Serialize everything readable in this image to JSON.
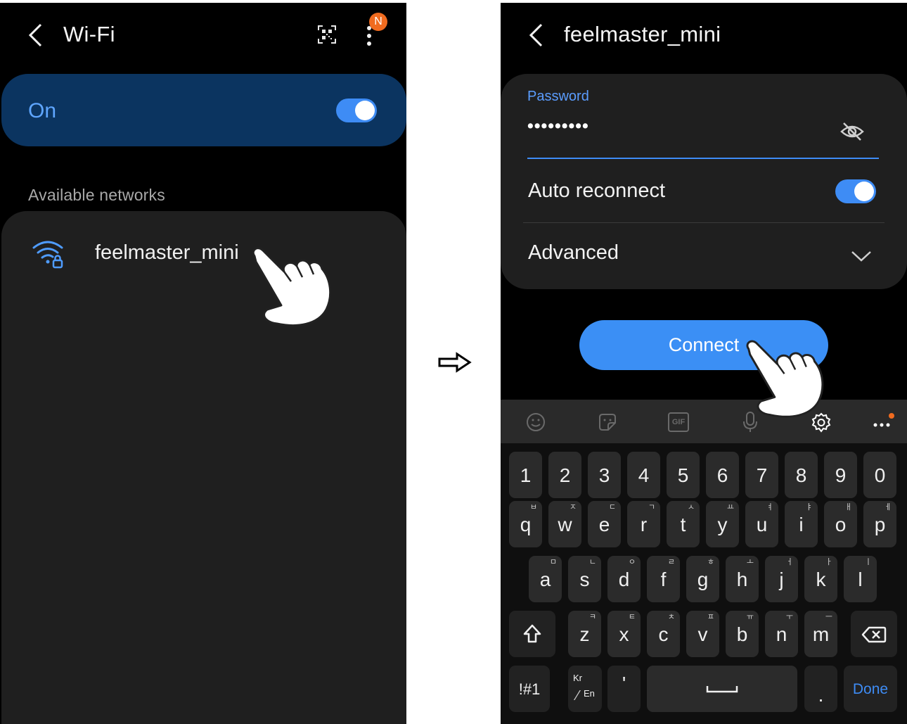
{
  "left_screen": {
    "title": "Wi-Fi",
    "notification_badge": "N",
    "wifi_toggle_label": "On",
    "section_header": "Available networks",
    "networks": [
      {
        "name": "feelmaster_mini",
        "secured": true
      }
    ]
  },
  "transition_arrow": "⇨",
  "right_screen": {
    "title": "feelmaster_mini",
    "password_label": "Password",
    "password_value": "•••••••••",
    "auto_reconnect_label": "Auto reconnect",
    "advanced_label": "Advanced",
    "connect_button": "Connect",
    "keyboard": {
      "number_row": [
        "1",
        "2",
        "3",
        "4",
        "5",
        "6",
        "7",
        "8",
        "9",
        "0"
      ],
      "row1": [
        {
          "key": "q",
          "sub": "ㅂ"
        },
        {
          "key": "w",
          "sub": "ㅈ"
        },
        {
          "key": "e",
          "sub": "ㄷ"
        },
        {
          "key": "r",
          "sub": "ㄱ"
        },
        {
          "key": "t",
          "sub": "ㅅ"
        },
        {
          "key": "y",
          "sub": "ㅛ"
        },
        {
          "key": "u",
          "sub": "ㅕ"
        },
        {
          "key": "i",
          "sub": "ㅑ"
        },
        {
          "key": "o",
          "sub": "ㅐ"
        },
        {
          "key": "p",
          "sub": "ㅔ"
        }
      ],
      "row2": [
        {
          "key": "a",
          "sub": "ㅁ"
        },
        {
          "key": "s",
          "sub": "ㄴ"
        },
        {
          "key": "d",
          "sub": "ㅇ"
        },
        {
          "key": "f",
          "sub": "ㄹ"
        },
        {
          "key": "g",
          "sub": "ㅎ"
        },
        {
          "key": "h",
          "sub": "ㅗ"
        },
        {
          "key": "j",
          "sub": "ㅓ"
        },
        {
          "key": "k",
          "sub": "ㅏ"
        },
        {
          "key": "l",
          "sub": "ㅣ"
        }
      ],
      "row3": [
        {
          "key": "z",
          "sub": "ㅋ"
        },
        {
          "key": "x",
          "sub": "ㅌ"
        },
        {
          "key": "c",
          "sub": "ㅊ"
        },
        {
          "key": "v",
          "sub": "ㅍ"
        },
        {
          "key": "b",
          "sub": "ㅠ"
        },
        {
          "key": "n",
          "sub": "ㅜ"
        },
        {
          "key": "m",
          "sub": "ㅡ"
        }
      ],
      "symbols_key": "!#1",
      "lang_key_top": "Kr",
      "lang_key_bottom": "En",
      "apostrophe_key": "'",
      "period_key": ".",
      "done_key": "Done"
    },
    "toolbar_icons": [
      "emoji-icon",
      "sticker-icon",
      "gif-icon",
      "microphone-icon",
      "settings-icon",
      "more-icon"
    ],
    "gif_label": "GIF"
  },
  "colors": {
    "accent_blue": "#3e8cf5",
    "on_card": "#0b3460",
    "badge_orange": "#f06b1f"
  }
}
